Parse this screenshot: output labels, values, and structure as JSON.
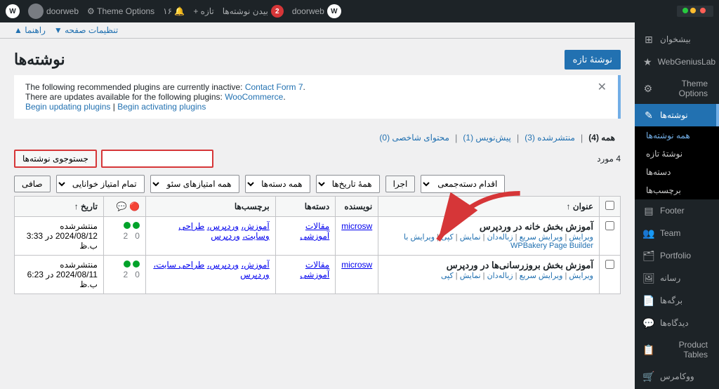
{
  "adminBar": {
    "windowTitle": "doorweb",
    "wpLogoText": "W",
    "siteLabel": "doorweb",
    "notifCount": "2",
    "navItems": [
      "بیدن نوشته‌ها",
      "تازه",
      "+",
      "۱۶",
      "Theme Options"
    ],
    "userName": "doorweb",
    "settingsIcon": "⚙"
  },
  "topMenus": {
    "item1": "تنظیمات صفحه ▼",
    "item2": "راهنما ▲"
  },
  "page": {
    "title": "نوشته‌ها",
    "newButtonLabel": "نوشتهٔ تازه"
  },
  "notice": {
    "line1": "The following recommended plugins are currently inactive: ",
    "link1": "Contact Form 7",
    "line2": "There are updates available for the following plugins: ",
    "link2": "WooCommerce",
    "link3": "Begin updating plugins",
    "sep": "|",
    "link4": "Begin activating plugins"
  },
  "tabs": {
    "all": "همه (4)",
    "published": "منتشرشده (3)",
    "draft": "پیش‌نویس (1)",
    "personal": "محتوای شاخصی (0)"
  },
  "toolbar": {
    "bulkAction": "اقدام دسته‌جمعی",
    "apply": "اجرا",
    "allDates": "همهٔ تاریخ‌ها",
    "allCategories": "همه دسته‌ها",
    "allMeta": "همه امتیازهای سئو",
    "allReadability": "تمام امتیاز خوانایی",
    "filterButton": "صافی"
  },
  "search": {
    "placeholder": "",
    "buttonLabel": "جستوجوی نوشته‌ها",
    "countInfo": "4 مورد"
  },
  "tableHeaders": {
    "checkbox": "",
    "title": "عنوان ↑",
    "author": "نویسنده",
    "categories": "دسته‌ها",
    "tags": "برچسب‌ها",
    "comments": "💬",
    "date": "تاریخ ↑"
  },
  "posts": [
    {
      "title": "آموزش بخش خانه در وردپرس",
      "author": "microsw",
      "categories": "مقالات آموزشی",
      "tags": "آموزش، وردپرس، طراحی وسایت، وردپرس",
      "links": "ویرایش | ویرایش سریع | زباله‌دان | نمایش | کپی | ویرایش با WPBakery Page Builder",
      "comments": "2",
      "spam": "0",
      "status": "منتشرشده",
      "date": "2024/08/12 در 3:33 ب.ظ",
      "dotLeft": "green",
      "dotRight": "green"
    },
    {
      "title": "آموزش بخش بروزرسانی‌ها در وردپرس",
      "author": "microsw",
      "categories": "مقالات آموزشی",
      "tags": "آموزش، وردپرس، طراحی سایت، وردپرس",
      "links": "ویرایش | ویرایش سریع | زباله‌دان | نمایش | کپی",
      "comments": "2",
      "spam": "0",
      "status": "منتشرشده",
      "date": "2024/08/11 در 6:23 ب.ظ",
      "dotLeft": "green",
      "dotRight": "green"
    }
  ],
  "sidebar": {
    "items": [
      {
        "label": "بیشخوان",
        "icon": "⊞",
        "active": false
      },
      {
        "label": "WebGeniusLab",
        "icon": "★",
        "active": false
      },
      {
        "label": "Theme Options",
        "icon": "⚙",
        "active": false
      },
      {
        "label": "نوشته‌ها",
        "icon": "✎",
        "active": true
      },
      {
        "label": "Footer",
        "icon": "▤",
        "active": false
      },
      {
        "label": "Team",
        "icon": "👥",
        "active": false
      },
      {
        "label": "Portfolio",
        "icon": "🗂",
        "active": false
      },
      {
        "label": "رسانه",
        "icon": "🖼",
        "active": false
      },
      {
        "label": "برگه‌ها",
        "icon": "📄",
        "active": false
      },
      {
        "label": "دیدگاه‌ها",
        "icon": "💬",
        "active": false
      },
      {
        "label": "Product Tables",
        "icon": "📋",
        "active": false
      },
      {
        "label": "ووکامرس",
        "icon": "🛒",
        "active": false
      }
    ],
    "submenu": {
      "label": "همه نوشته‌ها",
      "items": [
        {
          "label": "همه نوشته‌ها",
          "active": true
        },
        {
          "label": "نوشتهٔ تازه",
          "active": false
        },
        {
          "label": "دسته‌ها",
          "active": false
        },
        {
          "label": "برچسب‌ها",
          "active": false
        }
      ]
    }
  }
}
